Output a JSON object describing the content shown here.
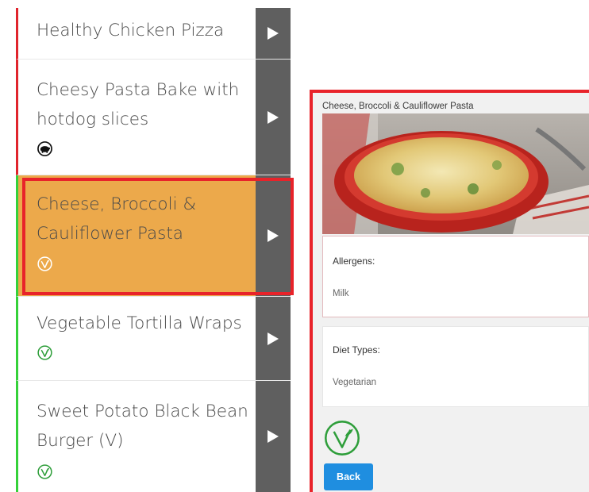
{
  "menu": {
    "items": [
      {
        "title": "Healthy Chicken Pizza",
        "diet": "none"
      },
      {
        "title": "Cheesy Pasta Bake with hotdog slices",
        "diet": "pork"
      },
      {
        "title": "Cheese, Broccoli & Cauliflower Pasta",
        "diet": "vegetarian",
        "selected": true
      },
      {
        "title": "Vegetable Tortilla Wraps",
        "diet": "vegetarian"
      },
      {
        "title": "Sweet Potato Black Bean Burger (V)",
        "diet": "vegetarian"
      }
    ]
  },
  "detail": {
    "title": "Cheese, Broccoli & Cauliflower Pasta",
    "allergens_label": "Allergens:",
    "allergens_value": "Milk",
    "diet_types_label": "Diet Types:",
    "diet_types_value": "Vegetarian",
    "back_label": "Back"
  },
  "colors": {
    "non_veg_bar": "#e0242c",
    "veg_bar": "#35d13a",
    "selected_bg": "#eca94b",
    "arrow_bg": "#5f5f5f",
    "highlight_outline": "#e8232a",
    "back_button": "#1f8ee0",
    "veg_icon": "#2e9e3a"
  },
  "icons": {
    "arrow": "play-arrow-icon",
    "pork": "pig-icon",
    "vegetarian": "vegetarian-leaf-icon"
  }
}
